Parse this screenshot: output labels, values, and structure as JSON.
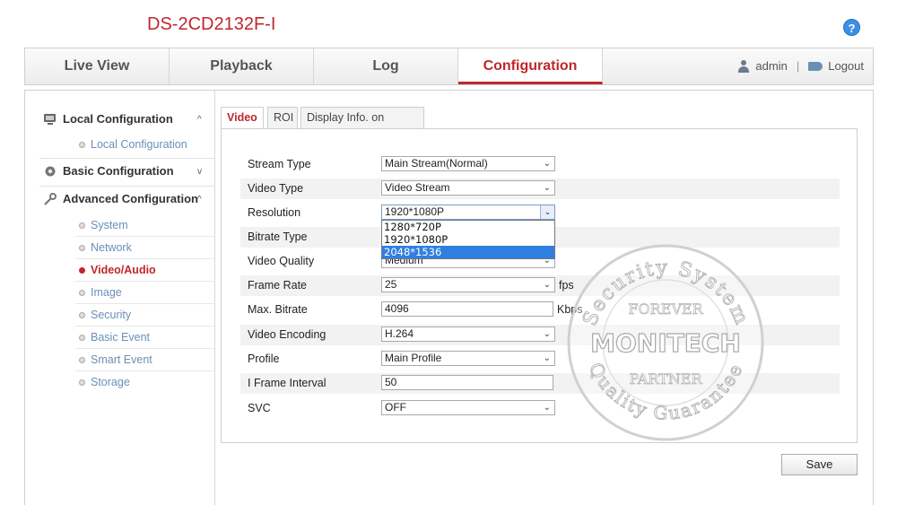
{
  "header": {
    "model": "DS-2CD2132F-I",
    "help_glyph": "?"
  },
  "nav": {
    "tabs": [
      {
        "label": "Live View"
      },
      {
        "label": "Playback"
      },
      {
        "label": "Log"
      },
      {
        "label": "Configuration"
      }
    ],
    "active_tab": "Configuration",
    "user": "admin",
    "separator": "|",
    "logout": "Logout"
  },
  "sidebar": {
    "local": {
      "label": "Local Configuration",
      "caret": "^",
      "items": [
        "Local Configuration"
      ]
    },
    "basic": {
      "label": "Basic Configuration",
      "caret": "v"
    },
    "advanced": {
      "label": "Advanced Configuration",
      "caret": "^",
      "items": [
        "System",
        "Network",
        "Video/Audio",
        "Image",
        "Security",
        "Basic Event",
        "Smart Event",
        "Storage"
      ],
      "active_item": "Video/Audio"
    }
  },
  "subtabs": {
    "items": [
      "Video",
      "ROI",
      "Display Info. on Stream"
    ],
    "active": "Video"
  },
  "form": {
    "stream_type": {
      "label": "Stream Type",
      "value": "Main Stream(Normal)"
    },
    "video_type": {
      "label": "Video Type",
      "value": "Video Stream"
    },
    "resolution": {
      "label": "Resolution",
      "value": "1920*1080P",
      "options": [
        "1280*720P",
        "1920*1080P",
        "2048*1536"
      ],
      "highlighted": "2048*1536"
    },
    "bitrate_type": {
      "label": "Bitrate Type"
    },
    "video_quality": {
      "label": "Video Quality",
      "value": "Medium"
    },
    "frame_rate": {
      "label": "Frame Rate",
      "value": "25",
      "unit": "fps"
    },
    "max_bitrate": {
      "label": "Max. Bitrate",
      "value": "4096",
      "unit": "Kbps"
    },
    "video_encoding": {
      "label": "Video Encoding",
      "value": "H.264"
    },
    "profile": {
      "label": "Profile",
      "value": "Main Profile"
    },
    "i_frame_interval": {
      "label": "I Frame Interval",
      "value": "50"
    },
    "svc": {
      "label": "SVC",
      "value": "OFF"
    }
  },
  "save_label": "Save",
  "watermark": {
    "top_arc": "Security System",
    "forever": "FOREVER",
    "brand": "MONITECH",
    "partner": "PARTNER",
    "bottom_arc": "Quality Guarantee"
  },
  "colors": {
    "accent": "#c0272d",
    "link": "#6a8fb5",
    "highlight": "#2f7fe0"
  }
}
